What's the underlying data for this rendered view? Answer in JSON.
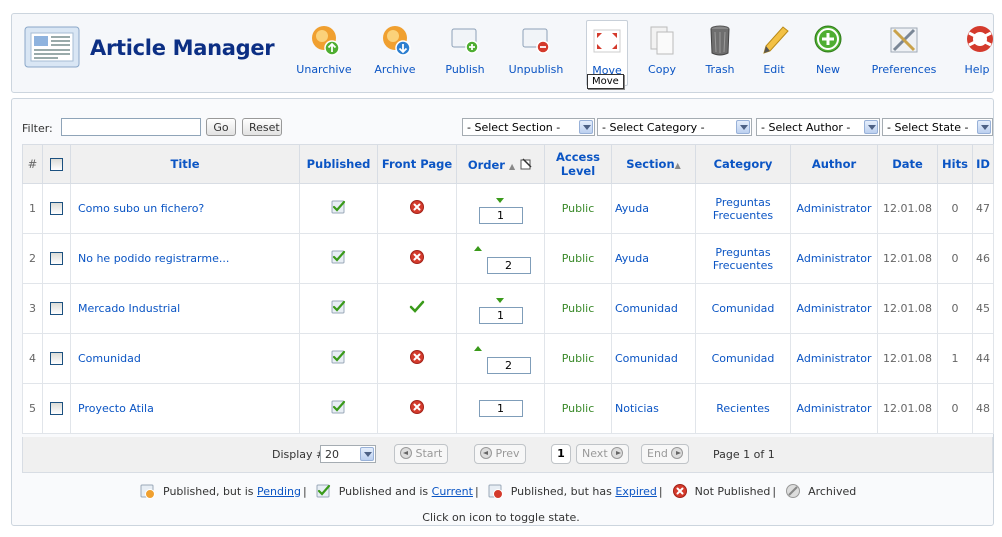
{
  "header": {
    "title": "Article Manager",
    "tooltip": "Move"
  },
  "toolbar": {
    "buttons": [
      {
        "label": "Unarchive",
        "icon": "unarchive-icon"
      },
      {
        "label": "Archive",
        "icon": "archive-icon"
      },
      {
        "label": "Publish",
        "icon": "publish-icon"
      },
      {
        "label": "Unpublish",
        "icon": "unpublish-icon"
      },
      {
        "label": "Move",
        "icon": "move-icon"
      },
      {
        "label": "Copy",
        "icon": "copy-icon"
      },
      {
        "label": "Trash",
        "icon": "trash-icon"
      },
      {
        "label": "Edit",
        "icon": "edit-icon"
      },
      {
        "label": "New",
        "icon": "new-icon"
      },
      {
        "label": "Preferences",
        "icon": "preferences-icon"
      },
      {
        "label": "Help",
        "icon": "help-icon"
      }
    ]
  },
  "filter": {
    "label": "Filter:",
    "value": "",
    "go": "Go",
    "reset": "Reset",
    "section": "- Select Section -",
    "category": "- Select Category -",
    "author": "- Select Author -",
    "state": "- Select State -"
  },
  "table": {
    "columns": {
      "num": "#",
      "title": "Title",
      "published": "Published",
      "front_page": "Front Page",
      "order": "Order",
      "access": "Access Level",
      "section": "Section",
      "category": "Category",
      "author": "Author",
      "date": "Date",
      "hits": "Hits",
      "id": "ID"
    },
    "rows": [
      {
        "num": "1",
        "title": "Como subo un fichero?",
        "published": "published",
        "front_page": "no",
        "order": "1",
        "order_arrows": "down",
        "access": "Public",
        "section": "Ayuda",
        "category": "Preguntas Frecuentes",
        "author": "Administrator",
        "date": "12.01.08",
        "hits": "0",
        "id": "47"
      },
      {
        "num": "2",
        "title": "No he podido registrarme...",
        "published": "published",
        "front_page": "no",
        "order": "2",
        "order_arrows": "up",
        "access": "Public",
        "section": "Ayuda",
        "category": "Preguntas Frecuentes",
        "author": "Administrator",
        "date": "12.01.08",
        "hits": "0",
        "id": "46"
      },
      {
        "num": "3",
        "title": "Mercado Industrial",
        "published": "published",
        "front_page": "yes",
        "order": "1",
        "order_arrows": "down",
        "access": "Public",
        "section": "Comunidad",
        "category": "Comunidad",
        "author": "Administrator",
        "date": "12.01.08",
        "hits": "0",
        "id": "45"
      },
      {
        "num": "4",
        "title": "Comunidad",
        "published": "published",
        "front_page": "no",
        "order": "2",
        "order_arrows": "up",
        "access": "Public",
        "section": "Comunidad",
        "category": "Comunidad",
        "author": "Administrator",
        "date": "12.01.08",
        "hits": "1",
        "id": "44"
      },
      {
        "num": "5",
        "title": "Proyecto Atila",
        "published": "published",
        "front_page": "no",
        "order": "1",
        "order_arrows": "none",
        "access": "Public",
        "section": "Noticias",
        "category": "Recientes",
        "author": "Administrator",
        "date": "12.01.08",
        "hits": "0",
        "id": "48"
      }
    ]
  },
  "pagination": {
    "display_label": "Display #",
    "display_value": "20",
    "start": "Start",
    "prev": "Prev",
    "current": "1",
    "next": "Next",
    "end": "End",
    "page_info": "Page 1 of 1"
  },
  "legend": {
    "pending_prefix": "Published, but is",
    "pending_link": "Pending",
    "current_prefix": "Published and is",
    "current_link": "Current",
    "expired_prefix": "Published, but has",
    "expired_link": "Expired",
    "not_published": "Not Published",
    "archived": "Archived",
    "hint": "Click on icon to toggle state."
  },
  "colors": {
    "title": "#0c2f84",
    "link": "#0b55c4",
    "accept_green": "#3a9a1a",
    "reject_red": "#d43a2c"
  }
}
